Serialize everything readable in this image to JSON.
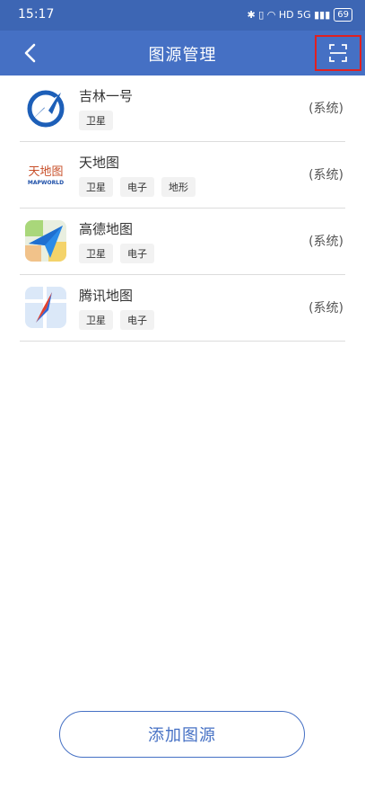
{
  "status": {
    "time": "15:17",
    "indicators": "✱ ▯ ◠ HD 5G ▮▮▮",
    "battery": "69"
  },
  "header": {
    "title": "图源管理",
    "back_icon": "chevron-left-icon",
    "scan_icon": "scan-icon"
  },
  "sources": [
    {
      "name": "吉林一号",
      "tags": [
        "卫星"
      ],
      "kind": "(系统)",
      "logo": "jilin-logo"
    },
    {
      "name": "天地图",
      "tags": [
        "卫星",
        "电子",
        "地形"
      ],
      "kind": "(系统)",
      "logo": "tianditu-logo",
      "logo_text": "天地图",
      "logo_subtext": "MAPWORLD"
    },
    {
      "name": "高德地图",
      "tags": [
        "卫星",
        "电子"
      ],
      "kind": "(系统)",
      "logo": "amap-logo"
    },
    {
      "name": "腾讯地图",
      "tags": [
        "卫星",
        "电子"
      ],
      "kind": "(系统)",
      "logo": "tencent-map-logo"
    }
  ],
  "footer": {
    "add_label": "添加图源"
  },
  "colors": {
    "primary": "#4570c4",
    "status_bar": "#3d66b4",
    "highlight": "#e02020"
  }
}
